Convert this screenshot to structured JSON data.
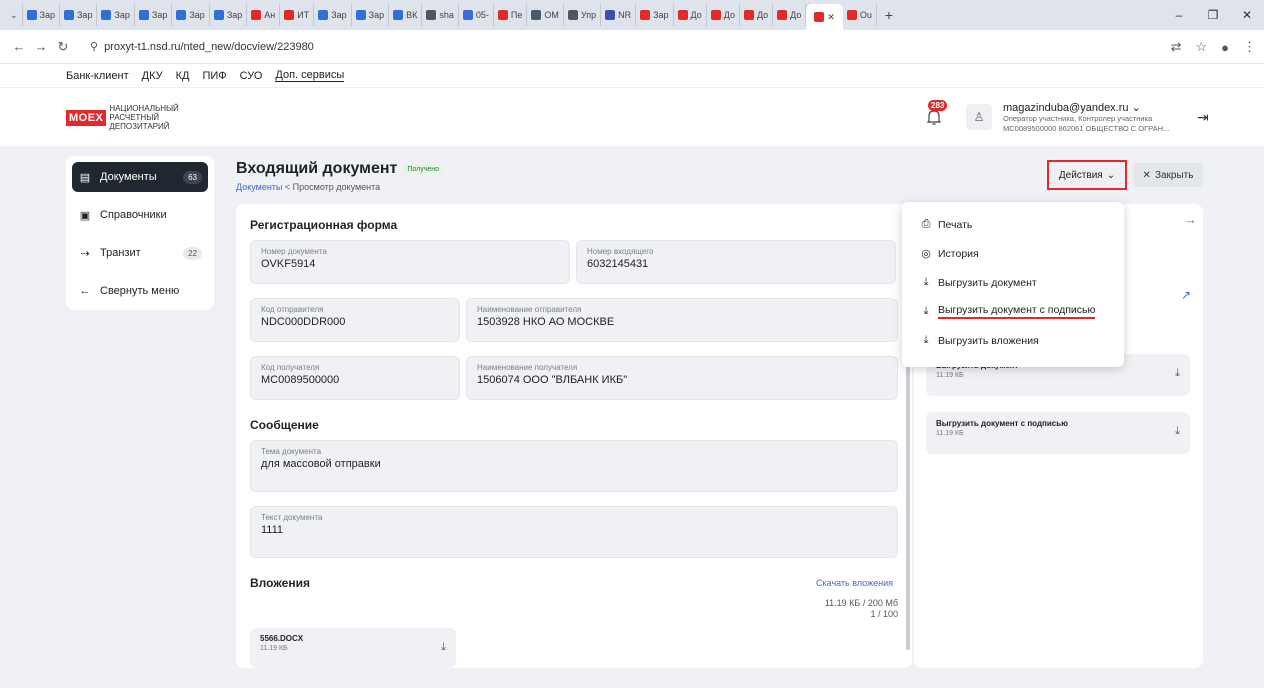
{
  "browser": {
    "tabs": [
      "Зар",
      "Зар",
      "Зар",
      "Зар",
      "Зар",
      "Зар",
      "Ан",
      "ИТ",
      "Зар",
      "Зар",
      "ВК",
      "sha",
      "05-",
      "Пе",
      "OM",
      "Упр",
      "NR",
      "Зар",
      "До",
      "До",
      "До",
      "До",
      "",
      "Ou"
    ],
    "url": "proxyt-t1.nsd.ru/nted_new/docview/223980"
  },
  "sitenav": [
    "Банк-клиент",
    "ДКУ",
    "КД",
    "ПИФ",
    "СУО",
    "Доп. сервисы"
  ],
  "header": {
    "logo_brand": "MOEX",
    "logo_lines": [
      "НАЦИОНАЛЬНЫЙ",
      "РАСЧЕТНЫЙ",
      "ДЕПОЗИТАРИЙ"
    ],
    "notifications": "283",
    "user_email": "magazinduba@yandex.ru",
    "user_role": "Оператор участника, Контролер участника",
    "user_org": "MC0089500000 862061 ОБЩЕСТВО С ОГРАН..."
  },
  "sidebar": {
    "items": [
      {
        "label": "Документы",
        "count": "63"
      },
      {
        "label": "Справочники",
        "count": ""
      },
      {
        "label": "Транзит",
        "count": "22"
      },
      {
        "label": "Свернуть меню",
        "count": ""
      }
    ]
  },
  "page": {
    "title": "Входящий документ",
    "status": "Получено",
    "breadcrumb_link": "Документы",
    "breadcrumb_sep": " < ",
    "breadcrumb_current": "Просмотр документа",
    "actions_label": "Действия",
    "close_label": "Закрыть"
  },
  "form": {
    "section_title": "Регистрационная форма",
    "doc_number_label": "Номер документа",
    "doc_number": "OVKF5914",
    "incoming_number_label": "Номер входящего",
    "incoming_number": "6032145431",
    "sender_code_label": "Код отправителя",
    "sender_code": "NDC000DDR000",
    "sender_name_label": "Наименование отправителя",
    "sender_name": "1503928 НКО АО МОСКВЕ",
    "recipient_code_label": "Код получателя",
    "recipient_code": "MC0089500000",
    "recipient_name_label": "Наименование получателя",
    "recipient_name": "1506074 ООО \"ВЛБАНК ИКБ\"",
    "message_title": "Сообщение",
    "subject_label": "Тема документа",
    "subject": "для массовой отправки",
    "text_label": "Текст документа",
    "text": "1111",
    "attachments_title": "Вложения",
    "download_attachments": "Скачать вложения",
    "size_used": "11.19 КБ / 200 Мб",
    "count_used": "1 / 100",
    "attachment_name": "5566.DOCX",
    "attachment_size": "11.19 КБ"
  },
  "right_panel": {
    "items": [
      {
        "title": "Выгрузить документ",
        "size": "11.19 КБ"
      },
      {
        "title": "Выгрузить документ с подписью",
        "size": "11.19 КБ"
      }
    ]
  },
  "dropdown": {
    "items": [
      "Печать",
      "История",
      "Выгрузить документ",
      "Выгрузить документ с подписью",
      "Выгрузить вложения"
    ]
  },
  "colors": {
    "brand_red": "#e32a2a",
    "accent_blue": "#3b6bd6",
    "sidebar_active": "#1f2731"
  }
}
